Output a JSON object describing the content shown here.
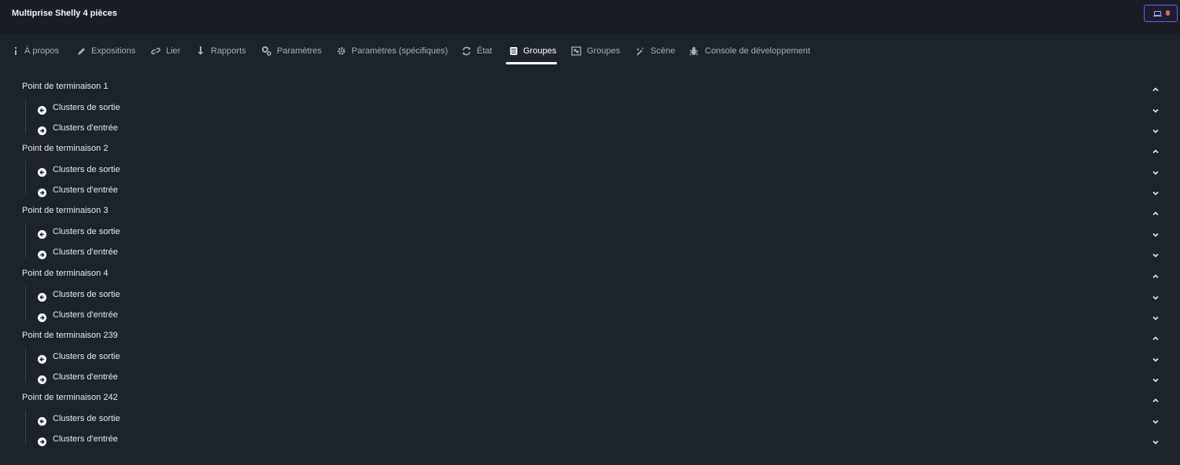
{
  "header": {
    "title": "Multiprise Shelly 4 pièces"
  },
  "tabs": [
    {
      "label": "À propos",
      "icon": "info-icon"
    },
    {
      "label": "Expositions",
      "icon": "pencil-icon"
    },
    {
      "label": "Lier",
      "icon": "link-icon"
    },
    {
      "label": "Rapports",
      "icon": "arrow-down-icon"
    },
    {
      "label": "Paramètres",
      "icon": "cogs-icon"
    },
    {
      "label": "Paramètres (spécifiques)",
      "icon": "gear-icon"
    },
    {
      "label": "État",
      "icon": "refresh-icon"
    },
    {
      "label": "Groupes",
      "icon": "list-icon",
      "active": true
    },
    {
      "label": "Groupes",
      "icon": "object-group-icon"
    },
    {
      "label": "Scène",
      "icon": "magic-wand-icon"
    },
    {
      "label": "Console de développement",
      "icon": "bug-icon"
    }
  ],
  "endpoints": [
    {
      "label": "Point de terminaison 1",
      "output": "Clusters de sortie",
      "input": "Clusters d'entrée"
    },
    {
      "label": "Point de terminaison 2",
      "output": "Clusters de sortie",
      "input": "Clusters d'entrée"
    },
    {
      "label": "Point de terminaison 3",
      "output": "Clusters de sortie",
      "input": "Clusters d'entrée"
    },
    {
      "label": "Point de terminaison 4",
      "output": "Clusters de sortie",
      "input": "Clusters d'entrée"
    },
    {
      "label": "Point de terminaison 239",
      "output": "Clusters de sortie",
      "input": "Clusters d'entrée"
    },
    {
      "label": "Point de terminaison 242",
      "output": "Clusters de sortie",
      "input": "Clusters d'entrée"
    }
  ],
  "colors": {
    "background": "#1d232a",
    "topbar": "#191e24",
    "accent": "#6d5cf2",
    "status_dot": "#f05a75"
  }
}
